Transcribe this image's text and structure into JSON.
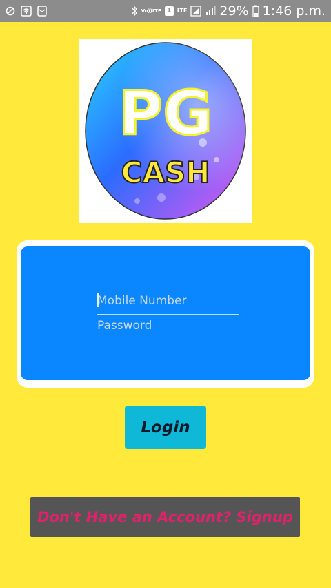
{
  "status_bar": {
    "icons_left": [
      "circle-icon",
      "wifi-share-icon",
      "mail-icon"
    ],
    "volte_top": "Vo))",
    "volte_bottom": "LTE",
    "sim_slot": "1",
    "network": "LTE",
    "battery_percent": "29%",
    "time": "1:46 p.m."
  },
  "logo": {
    "line1": "PG",
    "line2": "CASH"
  },
  "login_form": {
    "mobile_placeholder": "Mobile Number",
    "password_placeholder": "Password",
    "login_label": "Login"
  },
  "signup": {
    "label": "Don't Have an Account? Signup"
  },
  "colors": {
    "background": "#ffe93b",
    "panel": "#0a87ff",
    "login_button": "#10b8d8",
    "signup_button": "#555555",
    "signup_text": "#e0226a"
  }
}
